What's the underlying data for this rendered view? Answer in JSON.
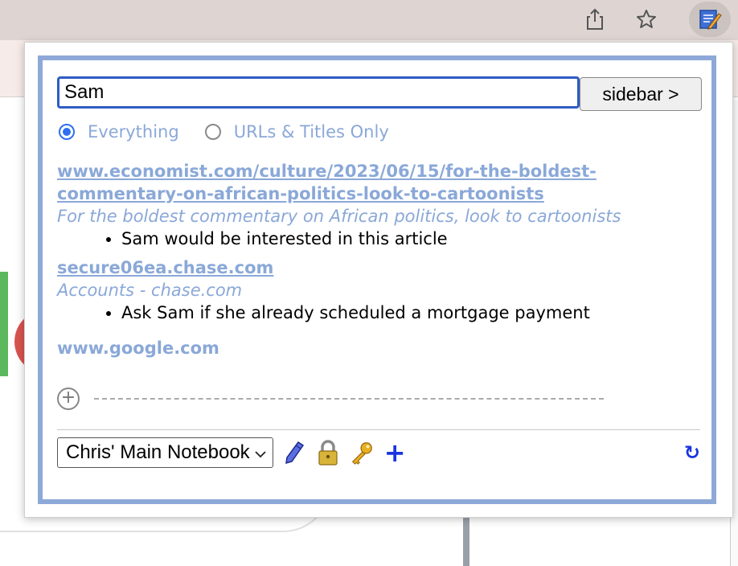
{
  "search": {
    "value": "Sam",
    "sidebar_label": "sidebar  >"
  },
  "filter": {
    "options": [
      {
        "label": "Everything",
        "checked": true
      },
      {
        "label": "URLs & Titles Only",
        "checked": false
      }
    ]
  },
  "results": [
    {
      "url": "www.economist.com/culture/2023/06/15/for-the-boldest-commentary-on-african-politics-look-to-cartoonists",
      "title": "For the boldest commentary on African politics, look to cartoonists",
      "note": "Sam would be interested in this article"
    },
    {
      "url": "secure06ea.chase.com",
      "title": "Accounts - chase.com",
      "note": "Ask Sam if she already scheduled a mortgage payment"
    },
    {
      "url": "www.google.com"
    }
  ],
  "footer": {
    "notebook": "Chris' Main Notebook",
    "plus": "+",
    "refresh": "↻"
  },
  "icons": [
    "share-icon",
    "star-icon",
    "notepad-extension-icon",
    "pencil-icon",
    "lock-icon",
    "key-icon",
    "add-icon",
    "refresh-icon",
    "circle-plus-icon"
  ]
}
